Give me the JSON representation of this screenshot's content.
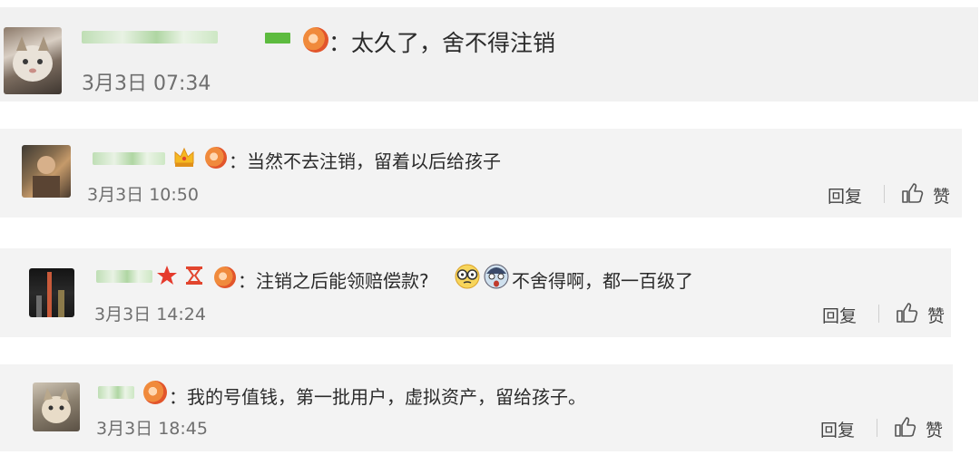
{
  "comments": [
    {
      "text": "：太久了，舍不得注销",
      "time": "3月3日 07:34"
    },
    {
      "text": "：当然不去注销，留着以后给孩子",
      "time": "3月3日 10:50",
      "reply_label": "回复",
      "like_label": "赞"
    },
    {
      "text_before": "：注销之后能领赔偿款?",
      "text_after": "不舍得啊，都一百级了",
      "time": "3月3日 14:24",
      "reply_label": "回复",
      "like_label": "赞"
    },
    {
      "text": "：我的号值钱，第一批用户，虚拟资产，留给孩子。",
      "time": "3月3日 18:45",
      "reply_label": "回复",
      "like_label": "赞"
    }
  ],
  "icons": {
    "like": "thumbs-up-icon",
    "vip": "flame-badge-icon",
    "crown": "crown-icon",
    "star": "star-icon",
    "emoji_glasses": "glasses-face-emoji",
    "emoji_scared": "scared-face-emoji"
  },
  "colors": {
    "card_bg": "#f3f3f3",
    "text": "#2b2b2b",
    "time": "#6f6f6f",
    "star": "#e53a2c"
  }
}
